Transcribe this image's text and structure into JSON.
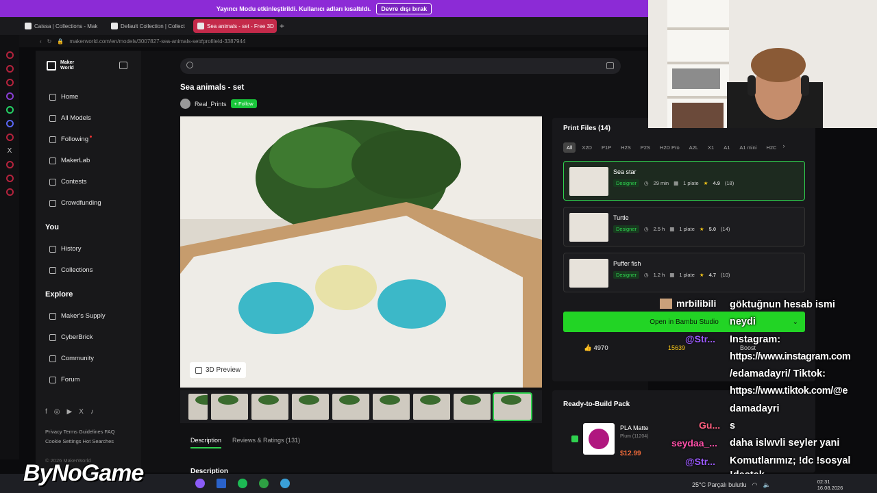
{
  "banner": {
    "text": "Yayıncı Modu etkinleştirildi. Kullanıcı adları kısaltıldı.",
    "button": "Devre dışı bırak"
  },
  "browser": {
    "tabs": [
      "Caissa | Collections - Mak",
      "Default Collection | Collect",
      "Sea animals - set - Free 3D"
    ],
    "url": "makerworld.com/en/models/3007827-sea-animals-set#profileId-3387944"
  },
  "sidebar": {
    "logo": [
      "Maker",
      "World"
    ],
    "items": [
      "Home",
      "All Models",
      "Following",
      "MakerLab",
      "Contests",
      "Crowdfunding"
    ],
    "you_title": "You",
    "you_items": [
      "History",
      "Collections"
    ],
    "explore_title": "Explore",
    "explore_items": [
      "Maker's Supply",
      "CyberBrick",
      "Community",
      "Forum"
    ],
    "footer1": "Privacy  Terms  Guidelines  FAQ",
    "footer2": "Cookie Settings  Hot Searches",
    "copyright": "© 2026 MakerWorld"
  },
  "model": {
    "title": "Sea animals - set",
    "author": "Real_Prints",
    "follow": "+ Follow",
    "preview_button": "3D Preview",
    "tab_description": "Description",
    "tab_reviews": "Reviews & Ratings (131)",
    "description_title": "Description"
  },
  "print_files": {
    "title": "Print Files (14)",
    "chips": [
      "All",
      "X2D",
      "P1P",
      "H2S",
      "P2S",
      "H2D Pro",
      "A2L",
      "X1",
      "A1",
      "A1 mini",
      "H2C"
    ],
    "files": [
      {
        "name": "Sea star",
        "badge": "Designer",
        "time": "29 min",
        "plate": "1 plate",
        "rating": "4.9",
        "count": "(18)"
      },
      {
        "name": "Turtle",
        "badge": "Designer",
        "time": "2.5 h",
        "plate": "1 plate",
        "rating": "5.0",
        "count": "(14)"
      },
      {
        "name": "Puffer fish",
        "badge": "Designer",
        "time": "1.2 h",
        "plate": "1 plate",
        "rating": "4.7",
        "count": "(10)"
      }
    ],
    "open_button": "Open in Bambu Studio",
    "likes": "4970",
    "boosts": "15639",
    "boost_label": "Boost"
  },
  "ready": {
    "title": "Ready-to-Build Pack",
    "item": "PLA Matte",
    "sub": "Plum (11204)",
    "price": "$12.99"
  },
  "chat": {
    "names": [
      "mrbilibili",
      "@Str...",
      "Gu...",
      "seydaa_...",
      "@Str..."
    ],
    "lines": [
      "göktuğnun hesab ismi",
      "neydi",
      "Instagram:",
      "https://www.instagram.com",
      "/edamadayri/ Tiktok:",
      "https://www.tiktok.com/@e",
      "damadayri",
      "s",
      "daha islwvli seyler yani",
      "Komutlarımız; !dc !sosyal",
      "!destek"
    ]
  },
  "overlay": {
    "brand": "ByNoGame"
  },
  "taskbar": {
    "weather": "25°C  Parçalı bulutlu",
    "time": "02:31",
    "date": "16.08.2026"
  }
}
